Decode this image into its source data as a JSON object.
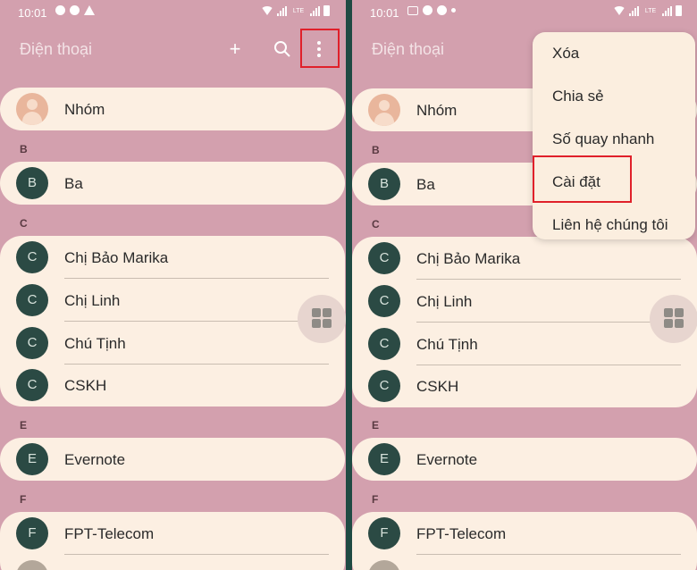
{
  "status_bar": {
    "time": "10:01"
  },
  "app_bar": {
    "title": "Điện thoại",
    "add_icon": "+"
  },
  "contacts": {
    "group_label": "Nhóm",
    "sections": [
      {
        "letter": "B",
        "names": [
          "Ba"
        ],
        "initial": "B"
      },
      {
        "letter": "C",
        "names": [
          "Chị Bảo Marika",
          "Chị Linh",
          "Chú Tịnh",
          "CSKH"
        ],
        "initial": "C"
      },
      {
        "letter": "E",
        "names": [
          "Evernote"
        ],
        "initial": "E"
      },
      {
        "letter": "F",
        "names": [
          "FPT-Telecom"
        ],
        "initial": "F"
      }
    ]
  },
  "menu": {
    "items": [
      "Xóa",
      "Chia sẻ",
      "Số quay nhanh",
      "Cài đặt",
      "Liên hệ chúng tôi"
    ],
    "highlighted": "Cài đặt"
  },
  "icons": {
    "search": "search-icon",
    "more": "more-vert-icon",
    "add": "plus-icon",
    "fab": "grid-icon"
  },
  "colors": {
    "background": "#d3a0ae",
    "card": "#fcefe2",
    "avatar": "#2b4a44",
    "highlight": "#e0202a",
    "divider_frame": "#1f4a43"
  }
}
